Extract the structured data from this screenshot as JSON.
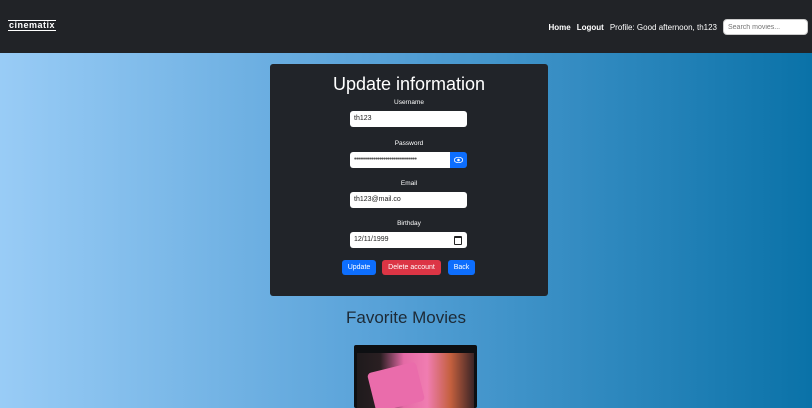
{
  "nav": {
    "logo": "cinematix",
    "home": "Home",
    "logout": "Logout",
    "greeting": "Profile: Good afternoon, th123",
    "search_placeholder": "Search movies..."
  },
  "form": {
    "title": "Update information",
    "username_label": "Username",
    "username_value": "th123",
    "password_label": "Password",
    "password_value": "••••••••••••••••••••••••••••••••",
    "email_label": "Email",
    "email_value": "th123@mail.co",
    "birthday_label": "Birthday",
    "birthday_value": "12/11/1999",
    "update_button": "Update",
    "delete_button": "Delete account",
    "back_button": "Back"
  },
  "favorites": {
    "title": "Favorite Movies"
  },
  "icons": {
    "password_toggle": "eye-icon",
    "date_picker": "calendar-icon"
  },
  "colors": {
    "primary": "#0d6efd",
    "danger": "#dc3545",
    "card": "#212429",
    "navbar": "#212327"
  }
}
